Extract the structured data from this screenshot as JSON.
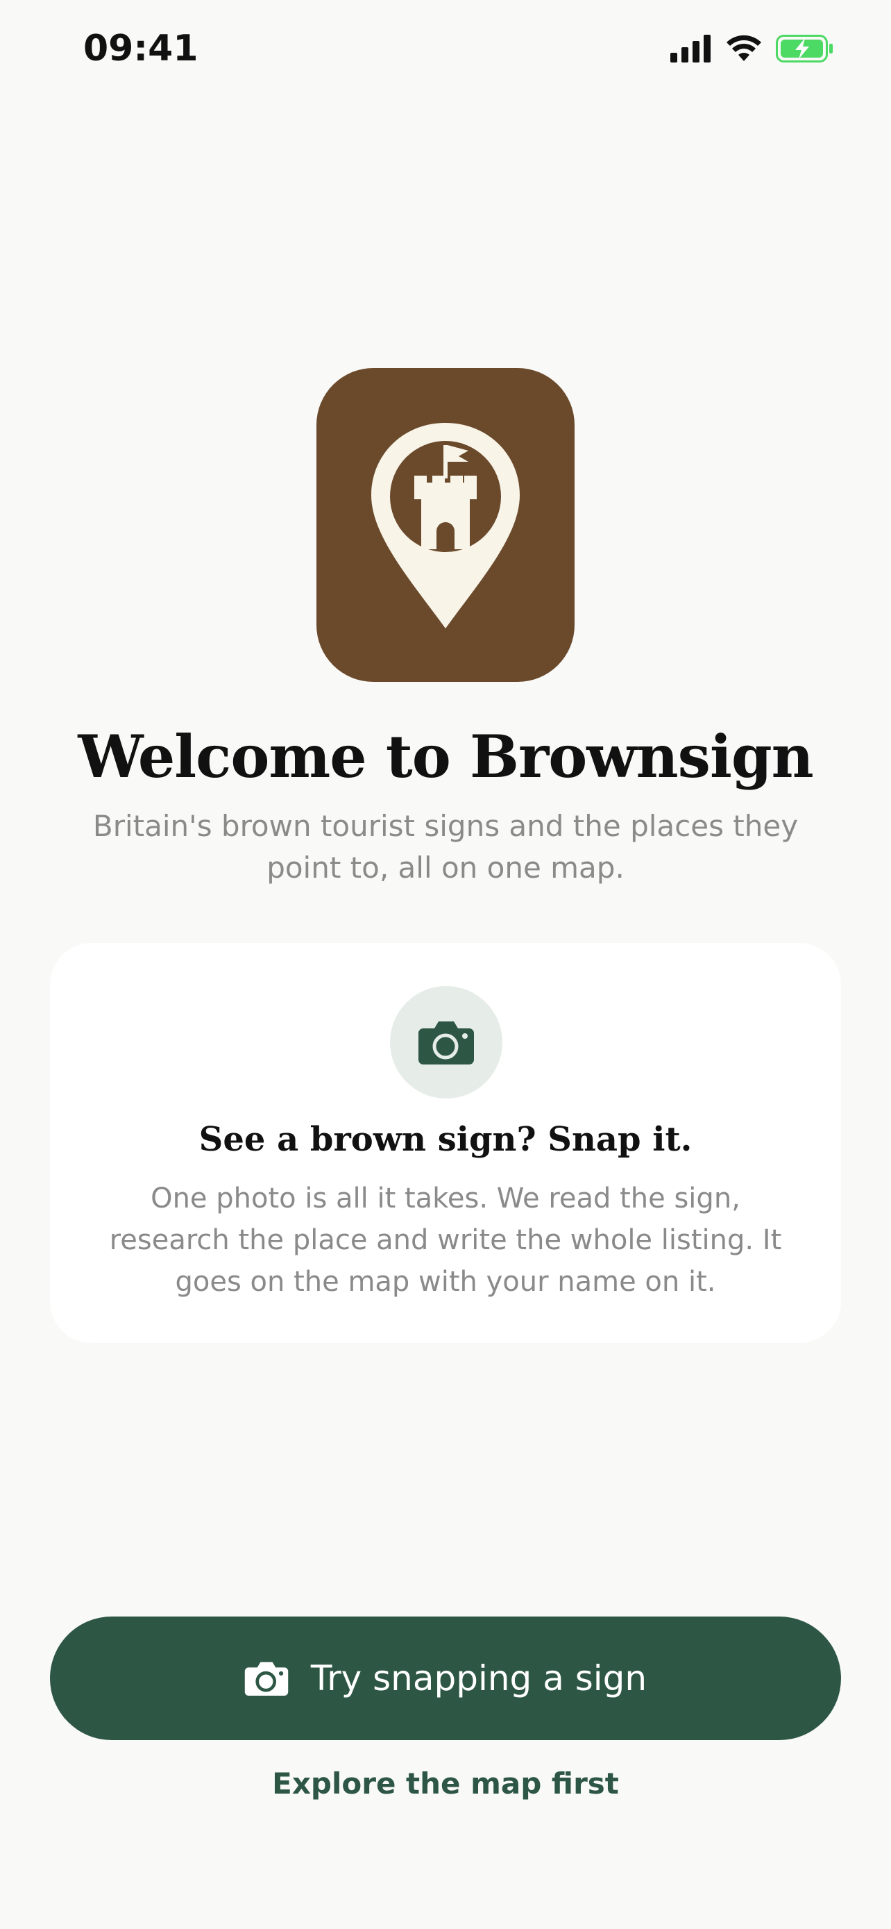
{
  "status_bar": {
    "time": "09:41",
    "icons": [
      "cellular-signal-icon",
      "wifi-icon",
      "battery-charging-icon"
    ]
  },
  "app_icon": {
    "icon": "castle-map-pin-icon",
    "background_color": "#6B4A2C"
  },
  "welcome": {
    "title": "Welcome to Brownsign",
    "subtitle": "Britain's brown tourist signs and the places they point to, all on one map."
  },
  "feature_card": {
    "icon": "camera-icon",
    "title": "See a brown sign? Snap it.",
    "body": "One photo is all it takes. We read the sign, research the place and write the whole listing. It goes on the map with your name on it."
  },
  "actions": {
    "primary_label": "Try snapping a sign",
    "primary_icon": "camera-icon",
    "secondary_label": "Explore the map first"
  },
  "colors": {
    "background": "#F9F9F7",
    "brand_brown": "#6B4A2C",
    "brand_green": "#2D5744",
    "muted_text": "#8A8A8A",
    "battery_green": "#4CD964"
  }
}
